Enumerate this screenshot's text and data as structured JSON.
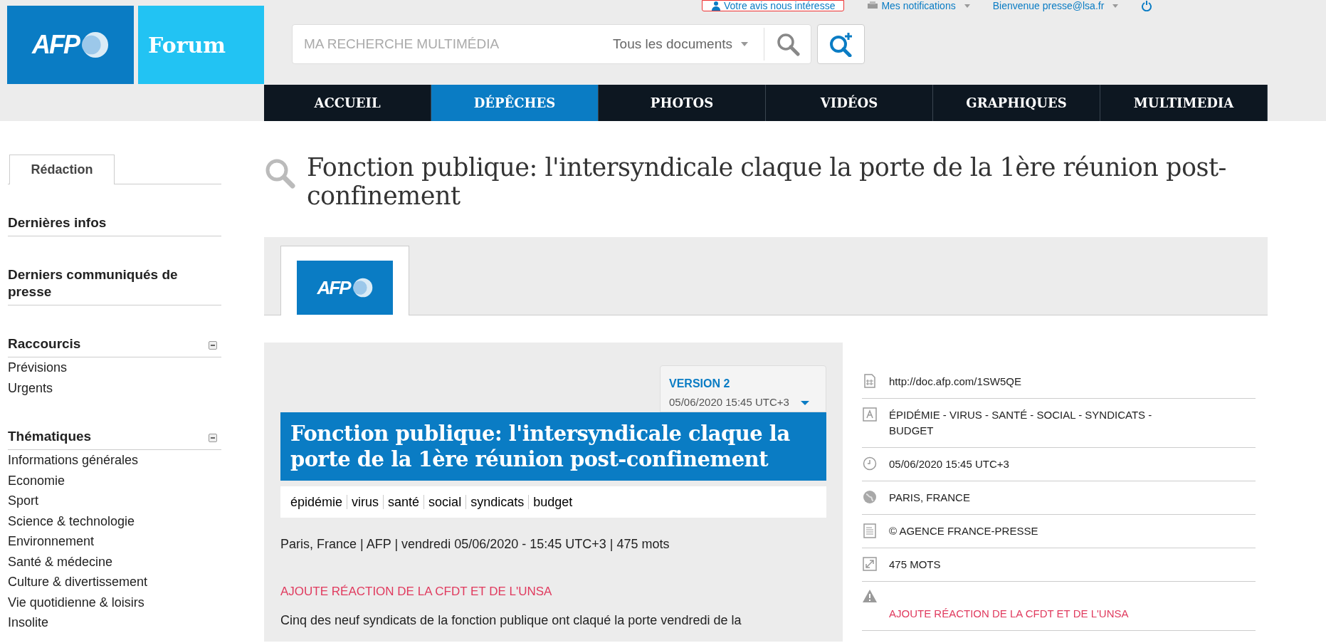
{
  "header": {
    "logo_text": "AFP",
    "forum_label": "Forum",
    "top_links": [
      {
        "kind": "feedback",
        "label": "Votre avis nous intéresse"
      },
      {
        "kind": "notifications",
        "label": "Mes notifications"
      },
      {
        "kind": "account",
        "label": "Bienvenue presse@lsa.fr"
      }
    ],
    "search": {
      "placeholder": "MA RECHERCHE MULTIMÉDIA",
      "scope": "Tous les documents"
    }
  },
  "nav": [
    {
      "label": "ACCUEIL",
      "selected": false
    },
    {
      "label": "DÉPÊCHES",
      "selected": true
    },
    {
      "label": "PHOTOS",
      "selected": false
    },
    {
      "label": "VIDÉOS",
      "selected": false
    },
    {
      "label": "GRAPHIQUES",
      "selected": false
    },
    {
      "label": "MULTIMEDIA",
      "selected": false
    }
  ],
  "sidebar": {
    "tab": "Rédaction",
    "sections": [
      {
        "title": "Dernières infos"
      },
      {
        "title": "Derniers communiqués de presse"
      },
      {
        "title": "Raccourcis",
        "expanded": true,
        "items": [
          "Prévisions",
          "Urgents"
        ]
      },
      {
        "title": "Thématiques",
        "expanded": true,
        "items": [
          "Informations générales",
          "Economie",
          "Sport",
          "Science & technologie",
          "Environnement",
          "Santé & médecine",
          "Culture & divertissement",
          "Vie quotidienne & loisirs",
          "Insolite"
        ]
      }
    ]
  },
  "page_title": "Fonction publique: l'intersyndicale claque la porte de la 1ère réunion post-confinement",
  "source_tab": {
    "logo_text": "AFP"
  },
  "article": {
    "version": "VERSION 2",
    "version_date": "05/06/2020 15:45 UTC+3",
    "headline": "Fonction publique: l'intersyndicale claque la porte de la 1ère réunion post-confinement",
    "tags": [
      "épidémie",
      "virus",
      "santé",
      "social",
      "syndicats",
      "budget"
    ],
    "byline": "Paris, France | AFP | vendredi 05/06/2020 - 15:45 UTC+3 | 475 mots",
    "note": "AJOUTE RÉACTION DE LA CFDT ET DE L'UNSA",
    "body": "Cinq des neuf syndicats de la fonction publique ont claqué la porte vendredi de la"
  },
  "meta": [
    {
      "kind": "link",
      "text": "http://doc.afp.com/1SW5QE"
    },
    {
      "kind": "keywords",
      "text": "ÉPIDÉMIE - VIRUS - SANTÉ - SOCIAL - SYNDICATS - BUDGET"
    },
    {
      "kind": "date",
      "text": "05/06/2020 15:45 UTC+3"
    },
    {
      "kind": "place",
      "text": "PARIS, FRANCE"
    },
    {
      "kind": "copyright",
      "text": "© AGENCE FRANCE-PRESSE"
    },
    {
      "kind": "size",
      "text": "475 MOTS"
    },
    {
      "kind": "warning",
      "text": "AJOUTE RÉACTION DE LA CFDT ET DE L'UNSA"
    }
  ]
}
